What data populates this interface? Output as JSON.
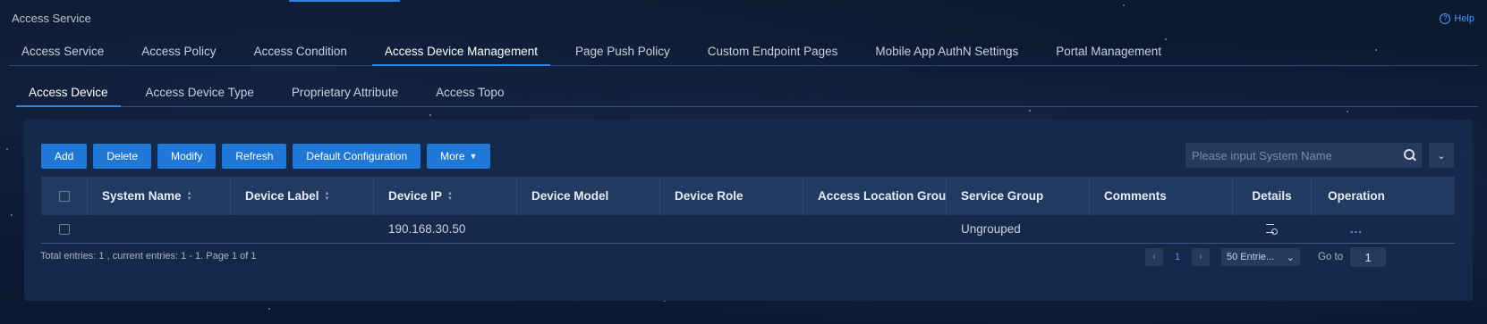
{
  "app": {
    "title": "Access Service",
    "help_label": "Help"
  },
  "main_tabs": [
    {
      "label": "Access Service"
    },
    {
      "label": "Access Policy"
    },
    {
      "label": "Access Condition"
    },
    {
      "label": "Access Device Management",
      "active": true
    },
    {
      "label": "Page Push Policy"
    },
    {
      "label": "Custom Endpoint Pages"
    },
    {
      "label": "Mobile App AuthN Settings"
    },
    {
      "label": "Portal Management"
    }
  ],
  "sub_tabs": [
    {
      "label": "Access Device",
      "active": true
    },
    {
      "label": "Access Device Type"
    },
    {
      "label": "Proprietary Attribute"
    },
    {
      "label": "Access Topo"
    }
  ],
  "toolbar": {
    "add": "Add",
    "delete": "Delete",
    "modify": "Modify",
    "refresh": "Refresh",
    "default_config": "Default Configuration",
    "more": "More"
  },
  "search": {
    "placeholder": "Please input System Name",
    "value": ""
  },
  "table": {
    "columns": {
      "system_name": "System Name",
      "device_label": "Device Label",
      "device_ip": "Device IP",
      "device_model": "Device Model",
      "device_role": "Device Role",
      "access_location_group": "Access Location Group",
      "service_group": "Service Group",
      "comments": "Comments",
      "details": "Details",
      "operation": "Operation"
    },
    "rows": [
      {
        "system_name": "",
        "device_label": "",
        "device_ip": "190.168.30.50",
        "device_model": "",
        "device_role": "",
        "access_location_group": "",
        "service_group": "Ungrouped",
        "comments": "",
        "operation": "..."
      }
    ]
  },
  "footer": {
    "summary": "Total entries: 1 , current entries: 1 - 1. Page 1 of 1",
    "current_page": "1",
    "page_size": "50 Entrie...",
    "goto_label": "Go to",
    "goto_value": "1"
  },
  "icons": {
    "help": "help-icon",
    "search": "search-icon",
    "expand": "chevron-down-icon",
    "details": "details-list-icon",
    "sort": "sort-icon"
  },
  "colors": {
    "accent": "#1f78d6",
    "link": "#4a9cf2",
    "panel": "#162a4c",
    "background": "#0c1a33"
  }
}
